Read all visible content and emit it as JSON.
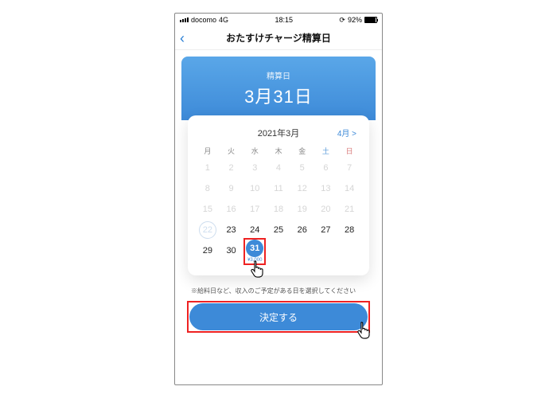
{
  "status": {
    "carrier": "docomo",
    "net": "4G",
    "time": "18:15",
    "battery_pct": "92%"
  },
  "nav": {
    "title": "おたすけチャージ精算日"
  },
  "hero": {
    "label": "精算日",
    "date": "3月31日"
  },
  "calendar": {
    "month_label": "2021年3月",
    "next_label": "4月 >",
    "dow": [
      "月",
      "火",
      "水",
      "木",
      "金",
      "土",
      "日"
    ],
    "weeks": [
      [
        {
          "n": "1",
          "d": true
        },
        {
          "n": "2",
          "d": true
        },
        {
          "n": "3",
          "d": true
        },
        {
          "n": "4",
          "d": true
        },
        {
          "n": "5",
          "d": true
        },
        {
          "n": "6",
          "d": true
        },
        {
          "n": "7",
          "d": true
        }
      ],
      [
        {
          "n": "8",
          "d": true
        },
        {
          "n": "9",
          "d": true
        },
        {
          "n": "10",
          "d": true
        },
        {
          "n": "11",
          "d": true
        },
        {
          "n": "12",
          "d": true
        },
        {
          "n": "13",
          "d": true
        },
        {
          "n": "14",
          "d": true
        }
      ],
      [
        {
          "n": "15",
          "d": true
        },
        {
          "n": "16",
          "d": true
        },
        {
          "n": "17",
          "d": true
        },
        {
          "n": "18",
          "d": true
        },
        {
          "n": "19",
          "d": true
        },
        {
          "n": "20",
          "d": true
        },
        {
          "n": "21",
          "d": true
        }
      ],
      [
        {
          "n": "22",
          "today": true
        },
        {
          "n": "23"
        },
        {
          "n": "24"
        },
        {
          "n": "25"
        },
        {
          "n": "26"
        },
        {
          "n": "27"
        },
        {
          "n": "28"
        }
      ],
      [
        {
          "n": "29"
        },
        {
          "n": "30"
        },
        {
          "n": "31",
          "sel": true,
          "under": "¥3,000"
        }
      ]
    ]
  },
  "note": "※給料日など、収入のご予定がある日を選択してください",
  "confirm": {
    "label": "決定する"
  }
}
